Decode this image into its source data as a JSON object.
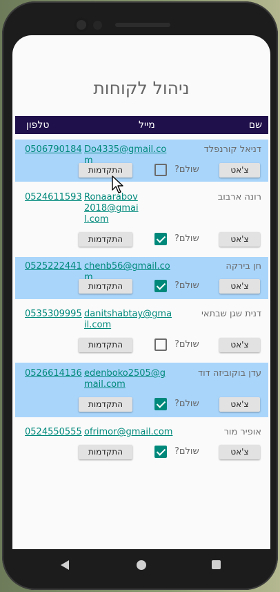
{
  "app": {
    "title": "ניהול לקוחות"
  },
  "table_header": {
    "name": "שם",
    "email": "מייל",
    "phone": "טלפון"
  },
  "labels": {
    "progress_button": "התקדמות",
    "chat_button": "צ'אט",
    "paid_question": "שולם?"
  },
  "colors": {
    "header_bg": "#1f0f4a",
    "row_highlight": "#a9d5fb",
    "accent": "#00897b"
  },
  "customers": [
    {
      "name": "דניאל קורנפלד",
      "email": "Do4335@gmail.com",
      "phone": "0506790184",
      "paid": false,
      "highlighted": true
    },
    {
      "name": "רונה ארבוב",
      "email": "Ronaarabov2018@gmail.com",
      "phone": "0524611593",
      "paid": true,
      "highlighted": false
    },
    {
      "name": "חן בירקה",
      "email": "chenb56@gmail.com",
      "phone": "0525222441",
      "paid": true,
      "highlighted": true
    },
    {
      "name": "דנית שגן שבתאי",
      "email": "danitshabtay@gmail.com",
      "phone": "0535309995",
      "paid": false,
      "highlighted": false
    },
    {
      "name": "עדן בוקוביזה דוד",
      "email": "edenboko2505@gmail.com",
      "phone": "0526614136",
      "paid": true,
      "highlighted": true
    },
    {
      "name": "אופיר מור",
      "email": "ofrimor@gmail.com",
      "phone": "0524550555",
      "paid": true,
      "highlighted": false
    }
  ],
  "nav_icons": [
    "back-icon",
    "home-icon",
    "recents-icon"
  ]
}
